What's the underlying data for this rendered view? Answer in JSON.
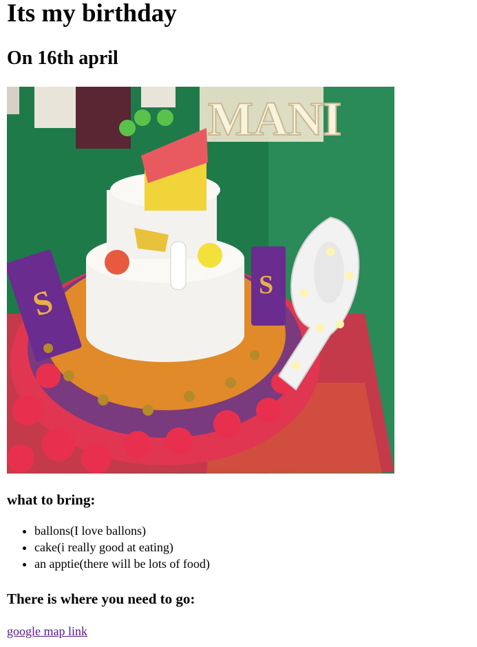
{
  "title": "Its my birthday",
  "subtitle": "On 16th april",
  "photo": {
    "subject": "birthday-cake-photo",
    "sign_letters": "MANI"
  },
  "bring_heading": "what to bring:",
  "bring_items": [
    "ballons(I love ballons)",
    "cake(i really good at eating)",
    "an apptie(there will be lots of food)"
  ],
  "go_heading": "There is where you need to go:",
  "map_link_label": "google map link",
  "colors": {
    "link_visited": "#551a8b",
    "carpet_green": "#1f7a4a",
    "cake_white": "#f4f2ee",
    "chocolate_purple": "#6a2c8e",
    "rose_red": "#e0314f"
  }
}
